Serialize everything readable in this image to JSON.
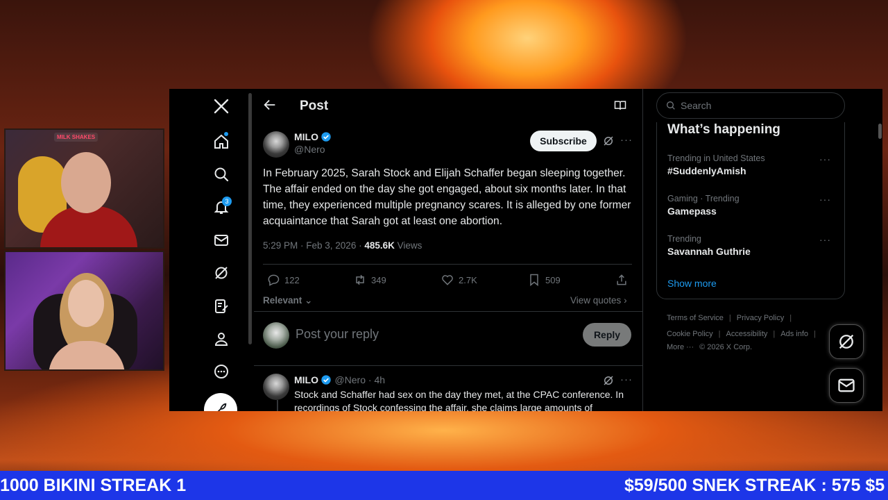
{
  "webcams": {
    "streamer1_sign": "MILK SHAKES"
  },
  "nav": {
    "notifications_badge": "3"
  },
  "post_header": {
    "title": "Post"
  },
  "post": {
    "author_name": "MILO",
    "author_handle": "@Nero",
    "subscribe_label": "Subscribe",
    "text": "In February 2025, Sarah Stock and Elijah Schaffer began sleeping together. The affair ended on the day she got engaged, about six months later. In that time, they experienced multiple pregnancy scares. It is alleged by one former acquaintance that Sarah got at least one abortion.",
    "time": "5:29 PM · Feb 3, 2026 · ",
    "views_count": "485.6K",
    "views_label": " Views",
    "replies": "122",
    "reposts": "349",
    "likes": "2.7K",
    "bookmarks": "509",
    "sort_label": "Relevant",
    "view_quotes": "View quotes"
  },
  "reply_composer": {
    "placeholder": "Post your reply",
    "button_label": "Reply"
  },
  "reply": {
    "author_name": "MILO",
    "author_handle": "@Nero · 4h",
    "text": "Stock and Schaffer had sex on the day they met, at the CPAC conference. In recordings of Stock confessing the affair, she claims large amounts of"
  },
  "sidebar": {
    "search_placeholder": "Search",
    "panel_title": "What’s happening",
    "trends": [
      {
        "category": "Trending in United States",
        "title": "#SuddenlyAmish"
      },
      {
        "category": "Gaming · Trending",
        "title": "Gamepass"
      },
      {
        "category": "Trending",
        "title": "Savannah Guthrie"
      }
    ],
    "show_more": "Show more",
    "footer_row1": [
      "Terms of Service",
      "Privacy Policy"
    ],
    "footer_row2": [
      "Cookie Policy",
      "Accessibility",
      "Ads info"
    ],
    "footer_more": "More ···",
    "footer_copyright": "© 2026 X Corp."
  },
  "ticker": {
    "left": "1000 BIKINI STREAK 1",
    "right": "$59/500 SNEK STREAK : 575 $5"
  },
  "colors": {
    "accent": "#1d9bf0",
    "ticker_bg": "#1d36e8"
  }
}
